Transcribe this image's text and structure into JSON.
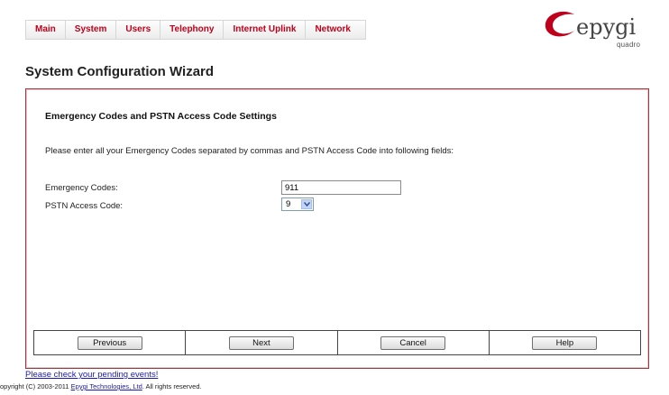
{
  "nav": {
    "items": [
      "Main",
      "System",
      "Users",
      "Telephony",
      "Internet Uplink",
      "Network"
    ]
  },
  "logo": {
    "brand": "epygi",
    "sub": "quadro"
  },
  "page": {
    "title": "System Configuration Wizard"
  },
  "panel": {
    "section_title": "Emergency Codes and PSTN Access Code Settings",
    "instructions": "Please enter all your Emergency Codes separated by commas and PSTN Access Code into following fields:",
    "emergency_label": "Emergency Codes:",
    "emergency_value": "911",
    "pstn_label": "PSTN Access Code:",
    "pstn_value": "9"
  },
  "buttons": {
    "previous": "Previous",
    "next": "Next",
    "cancel": "Cancel",
    "help": "Help"
  },
  "footer": {
    "pending": "Please check your pending events!",
    "copyright_prefix": "opyright (C) 2003-2011 ",
    "company": "Epygi Technologies, Ltd",
    "copyright_suffix": ". All rights reserved."
  },
  "colors": {
    "accent": "#c0001a",
    "panel_border": "#9b3a42",
    "link": "#1a1ab0"
  },
  "icons": {
    "dropdown": "chevron-down-icon",
    "logo": "epygi-swoosh-logo"
  }
}
